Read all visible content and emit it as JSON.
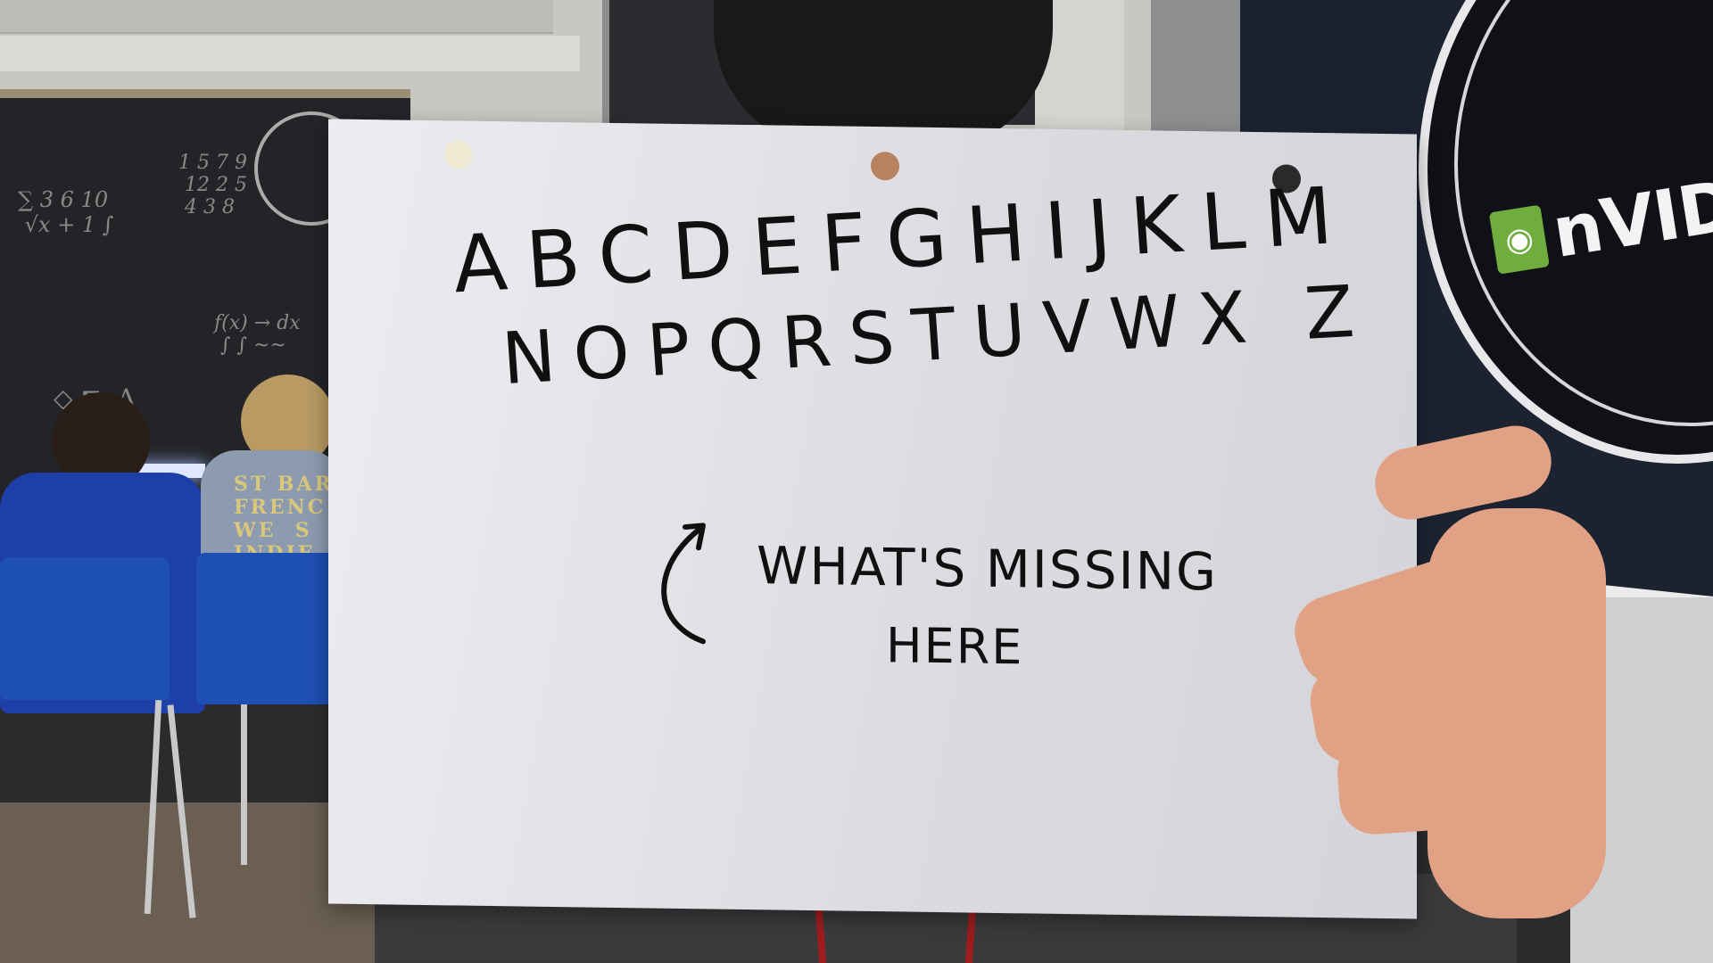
{
  "sign": {
    "alphabet_line_1": "ABCDEFGHIJKLM",
    "alphabet_line_2": "NOPQRSTUVWX Z",
    "note_line_1": "WHAT'S MISSING",
    "note_line_2": "HERE"
  },
  "shirt_print": "ST BART\nFRENC\nWE  S\nINDIE",
  "poster_brand": "nVIDIA",
  "colors": {
    "paper": "#e6e6ec",
    "ink": "#101010",
    "chair_blue": "#1e4fb3",
    "brand_green": "#6fae3e"
  }
}
